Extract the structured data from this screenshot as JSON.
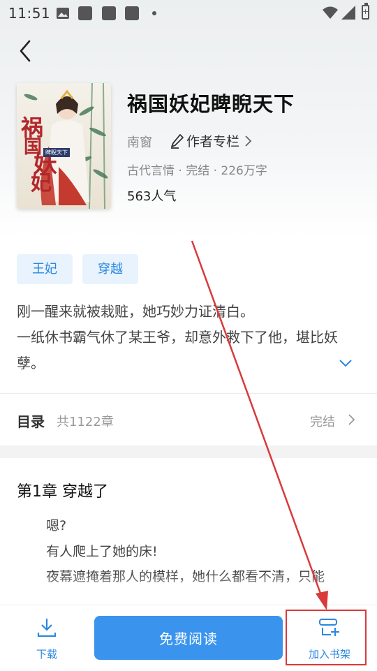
{
  "status_bar": {
    "time": "11:51"
  },
  "book": {
    "title": "祸国妖妃睥睨天下",
    "author": "南窗",
    "author_column_label": "作者专栏",
    "meta": "古代言情 · 完结 · 226万字",
    "popularity": "563人气",
    "cover_lettering": [
      "祸",
      "国",
      "妖",
      "妃",
      "睥睨天下"
    ]
  },
  "tags": [
    "王妃",
    "穿越"
  ],
  "description": [
    "刚一醒来就被栽赃，她巧妙力证清白。",
    "一纸休书霸气休了某王爷，却意外救下了他，堪比妖孽。"
  ],
  "toc": {
    "label": "目录",
    "count": "共1122章",
    "status": "完结"
  },
  "chapter": {
    "title": "第1章 穿越了",
    "paragraphs": [
      "嗯?",
      "有人爬上了她的床!",
      "夜幕遮掩着那人的模样，她什么都看不清，只能"
    ]
  },
  "bottom_bar": {
    "download_label": "下载",
    "read_label": "免费阅读",
    "shelf_label": "加入书架"
  },
  "colors": {
    "accent": "#3a94ee",
    "annotation": "#d93a3a",
    "tag_bg": "#e9f3fd"
  }
}
